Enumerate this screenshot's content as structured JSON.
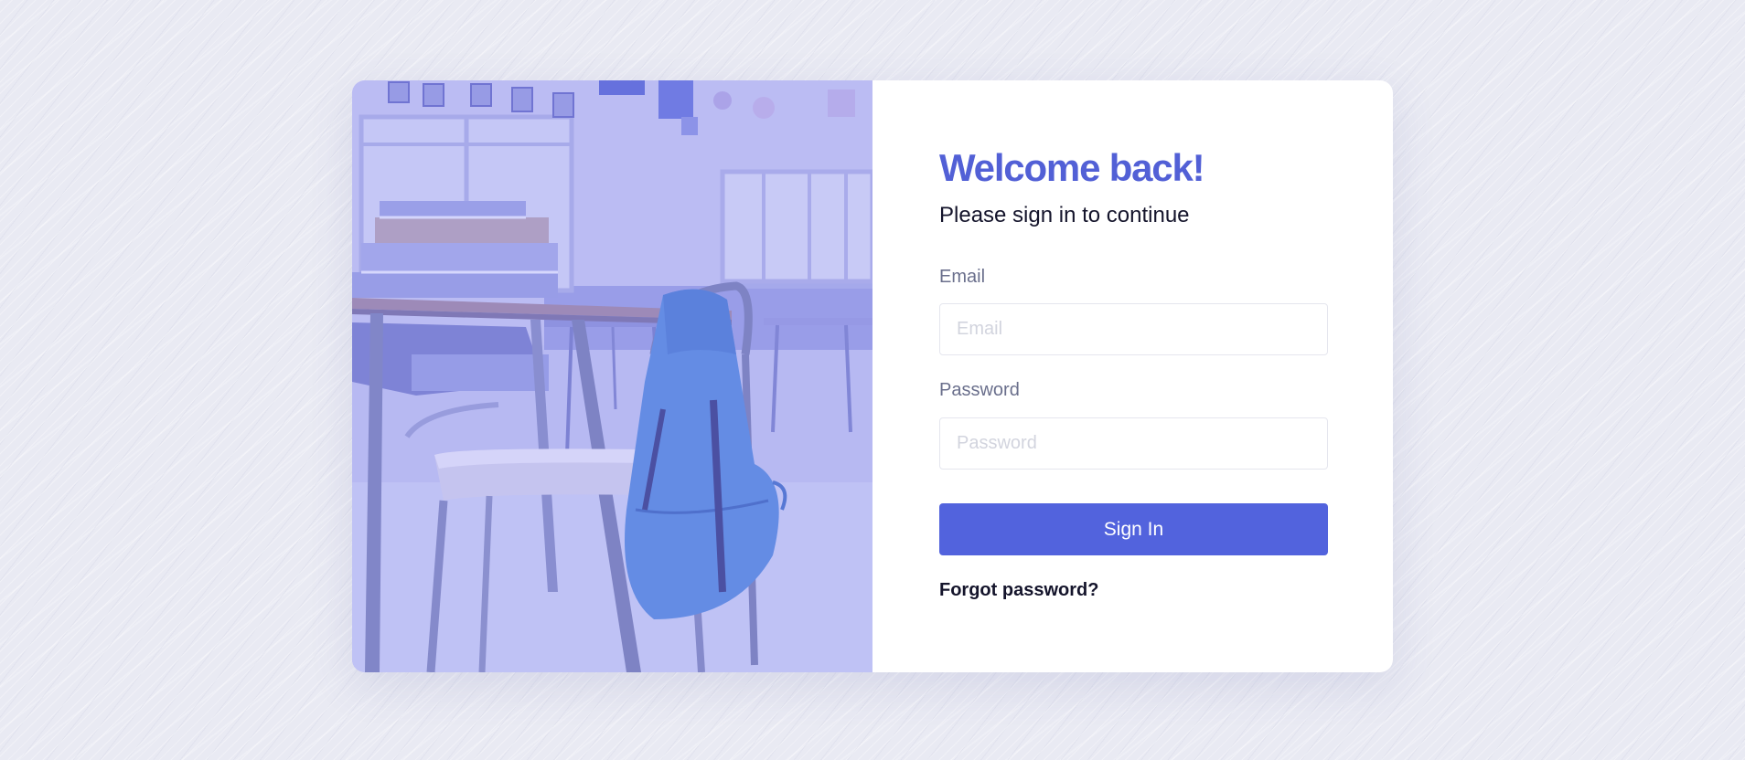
{
  "login": {
    "title": "Welcome back!",
    "subtitle": "Please sign in to continue",
    "email_label": "Email",
    "email_placeholder": "Email",
    "email_value": "",
    "password_label": "Password",
    "password_placeholder": "Password",
    "password_value": "",
    "submit_label": "Sign In",
    "forgot_label": "Forgot password?"
  },
  "hero": {
    "image": "classroom-photo",
    "overlay_color": "#8a8ef0"
  },
  "colors": {
    "accent": "#5263dd",
    "title": "#5260d6",
    "text": "#14142b",
    "label": "#6a6f8c"
  }
}
